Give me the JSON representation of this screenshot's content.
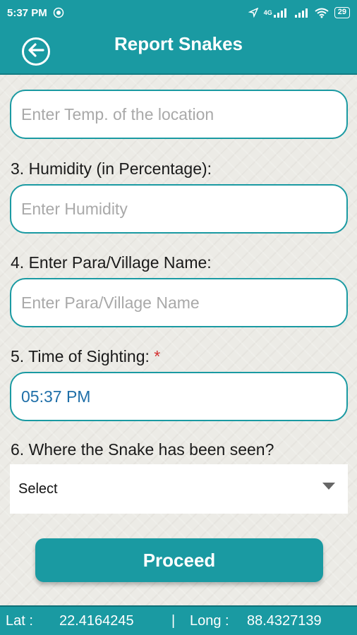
{
  "status": {
    "time": "5:37 PM",
    "network": "4G",
    "battery": "29"
  },
  "header": {
    "title": "Report Snakes"
  },
  "form": {
    "temp_placeholder": "Enter Temp. of the location",
    "humidity_label": "3. Humidity (in Percentage):",
    "humidity_placeholder": "Enter Humidity",
    "village_label": "4. Enter Para/Village Name:",
    "village_placeholder": "Enter Para/Village Name",
    "time_label": "5. Time of Sighting:",
    "required_mark": "*",
    "time_value": "05:37 PM",
    "location_label": "6. Where the Snake has been seen?",
    "location_select": "Select",
    "proceed_label": "Proceed"
  },
  "footer": {
    "lat_label": "Lat :",
    "lat_value": "22.4164245",
    "separator": "|",
    "long_label": "Long :",
    "long_value": "88.4327139"
  },
  "colors": {
    "primary": "#1a9aa2",
    "background": "#ecebe6",
    "required": "#d32f2f",
    "value_text": "#1f6fa8"
  },
  "icons": [
    "back-arrow-icon",
    "location-icon",
    "signal-icon",
    "wifi-icon",
    "battery-icon",
    "dropdown-arrow-icon",
    "app-icon"
  ]
}
